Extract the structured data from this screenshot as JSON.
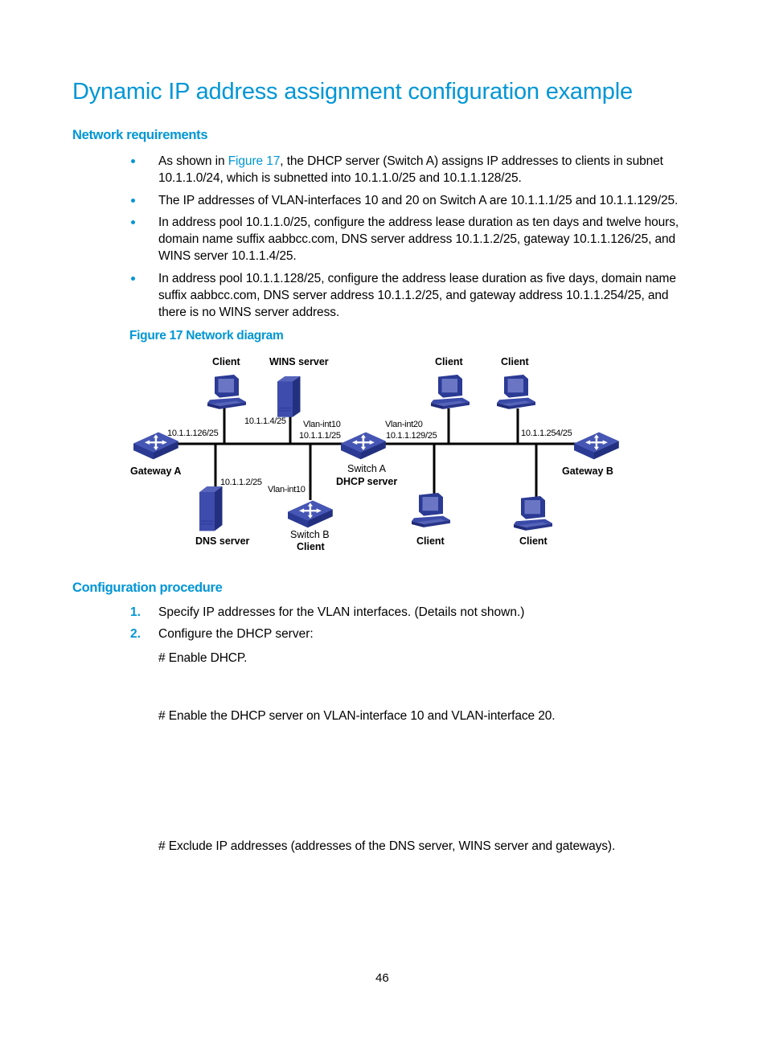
{
  "title": "Dynamic IP address assignment configuration example",
  "sections": {
    "network_requirements": {
      "heading": "Network requirements",
      "bullets": [
        {
          "pre": "As shown in ",
          "link": "Figure 17",
          "post_line1": ", the DHCP server (Switch A) assigns IP addresses to clients in subnet",
          "line2": "10.1.1.0/24, which is subnetted into 10.1.1.0/25 and 10.1.1.128/25."
        },
        {
          "line1": "The IP addresses of VLAN-interfaces 10 and 20 on Switch A are 10.1.1.1/25 and 10.1.1.129/25."
        },
        {
          "line1": "In address pool 10.1.1.0/25, configure the address lease duration as ten days and twelve hours,",
          "line2": "domain name suffix aabbcc.com, DNS server address 10.1.1.2/25, gateway 10.1.1.126/25, and",
          "line3": "WINS server 10.1.1.4/25."
        },
        {
          "line1": "In address pool 10.1.1.128/25, configure the address lease duration as five days, domain name",
          "line2": "suffix aabbcc.com, DNS server address 10.1.1.2/25, and gateway address 10.1.1.254/25, and",
          "line3": "there is no WINS server address."
        }
      ]
    },
    "figure": {
      "caption": "Figure 17 Network diagram",
      "labels": {
        "client_top1": "Client",
        "wins_server": "WINS server",
        "client_top2": "Client",
        "client_top3": "Client",
        "wins_ip": "10.1.1.4/25",
        "gw_a_ip": "10.1.1.126/25",
        "vlan10": "Vlan-int10",
        "vlan10_ip": "10.1.1.1/25",
        "vlan20": "Vlan-int20",
        "vlan20_ip": "10.1.1.129/25",
        "gw_b_ip": "10.1.1.254/25",
        "gateway_a": "Gateway A",
        "gateway_b": "Gateway B",
        "switch_a": "Switch A",
        "dhcp_server": "DHCP server",
        "dns_ip": "10.1.1.2/25",
        "switch_b_vlan": "Vlan-int10",
        "dns_server": "DNS server",
        "switch_b": "Switch B",
        "switch_b_role": "Client",
        "client_bottom1": "Client",
        "client_bottom2": "Client"
      },
      "switch_badge": "SWITCH"
    },
    "configuration_procedure": {
      "heading": "Configuration procedure",
      "steps": [
        {
          "number": "1.",
          "text": "Specify IP addresses for the VLAN interfaces. (Details not shown.)"
        },
        {
          "number": "2.",
          "text": "Configure the DHCP server:"
        }
      ],
      "comments": [
        "# Enable DHCP.",
        "# Enable the DHCP server on VLAN-interface 10 and VLAN-interface 20.",
        "# Exclude IP addresses (addresses of the DNS server, WINS server and gateways)."
      ]
    }
  },
  "page_number": "46",
  "colors": {
    "accent": "#0096d6",
    "device_blue": "#3a4aa8"
  }
}
